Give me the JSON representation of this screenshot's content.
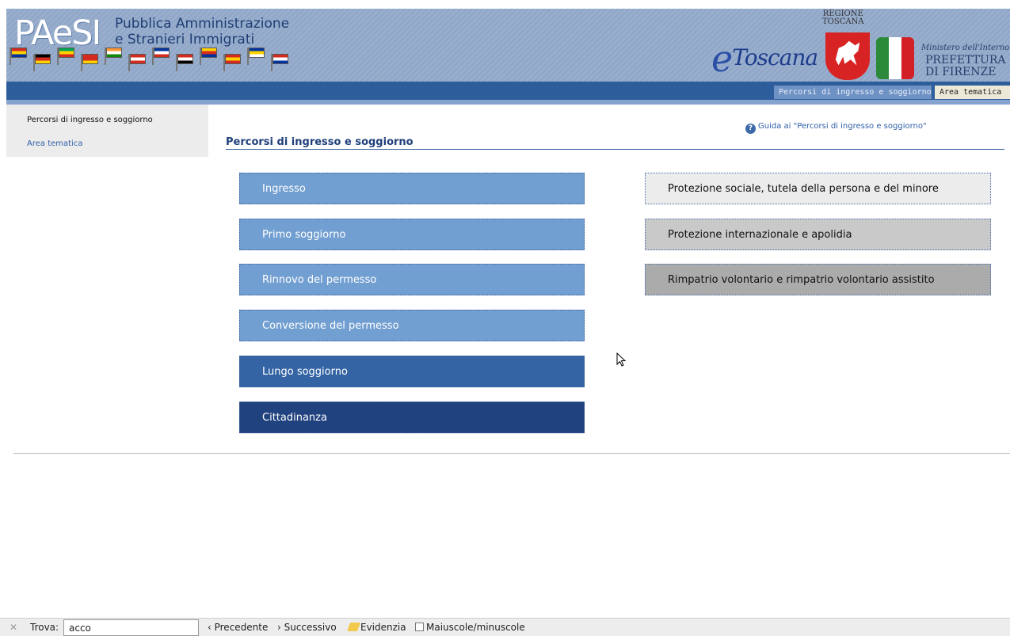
{
  "header": {
    "logo": "PAeSI",
    "subtitle_line1": "Pubblica Amministrazione",
    "subtitle_line2": "e Stranieri Immigrati",
    "etoscana_e": "e",
    "etoscana_word": "Toscana",
    "regione_line1": "REGIONE",
    "regione_line2": "TOSCANA",
    "ministero": "Ministero dell'Interno",
    "prefettura_line1": "PREFETTURA",
    "prefettura_line2": "DI FIRENZE",
    "italy_colors": [
      "#2a8a3a",
      "#ffffff",
      "#d32027"
    ]
  },
  "nav": {
    "tabs": [
      {
        "label": "Percorsi di ingresso e soggiorno",
        "active": true
      },
      {
        "label": "Area tematica",
        "active": false
      }
    ]
  },
  "sidebar": {
    "items": [
      {
        "label": "Percorsi di ingresso e soggiorno"
      },
      {
        "label": "Area tematica"
      }
    ]
  },
  "main": {
    "guide_link": "Guida ai \"Percorsi di ingresso e soggiorno\"",
    "help_icon": "?",
    "title": "Percorsi di ingresso e soggiorno",
    "left_buttons": [
      {
        "label": "Ingresso",
        "color": "#729fd1"
      },
      {
        "label": "Primo soggiorno",
        "color": "#729fd1"
      },
      {
        "label": "Rinnovo del permesso",
        "color": "#729fd1"
      },
      {
        "label": "Conversione del permesso",
        "color": "#729fd1"
      },
      {
        "label": "Lungo soggiorno",
        "color": "#3464a4"
      },
      {
        "label": "Cittadinanza",
        "color": "#20427f"
      }
    ],
    "right_buttons": [
      {
        "label": "Protezione sociale, tutela della persona e del minore",
        "color": "#ececec"
      },
      {
        "label": "Protezione internazionale e apolidia",
        "color": "#c9c9c9"
      },
      {
        "label": "Rimpatrio volontario e rimpatrio volontario assistito",
        "color": "#ababab"
      }
    ]
  },
  "findbar": {
    "close_icon": "✕",
    "label": "Trova:",
    "query": "acco",
    "prev_label": "‹ Precedente",
    "next_label": "› Successivo",
    "highlight_label": "Evidenzia",
    "case_label": "Maiuscole/minuscole"
  }
}
